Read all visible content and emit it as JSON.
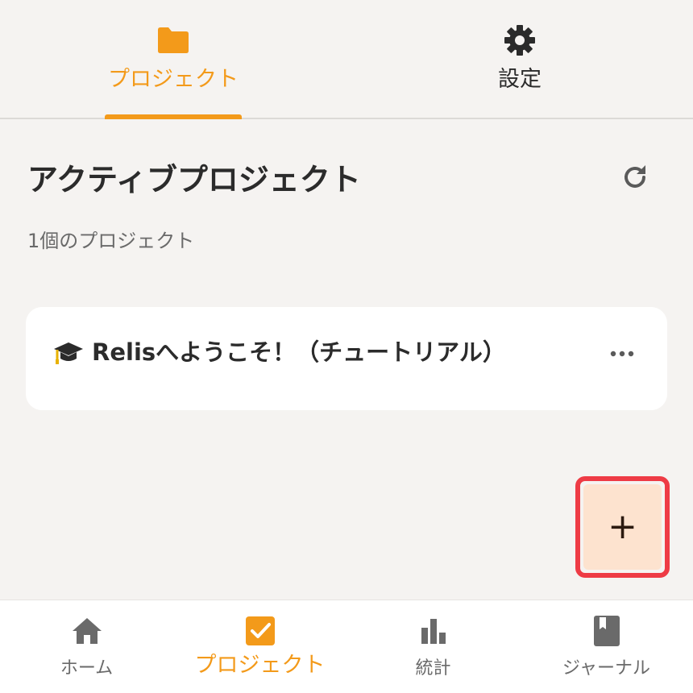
{
  "top_tabs": {
    "projects": {
      "label": "プロジェクト",
      "icon": "folder-icon"
    },
    "settings": {
      "label": "設定",
      "icon": "gear-icon"
    }
  },
  "section": {
    "title": "アクティブプロジェクト",
    "count_text": "1個のプロジェクト"
  },
  "project_card": {
    "icon": "graduation-cap-icon",
    "title": "Relisへようこそ！（チュートリアル）"
  },
  "fab": {
    "label": "+"
  },
  "bottom_nav": {
    "home": {
      "label": "ホーム",
      "icon": "home-icon"
    },
    "projects": {
      "label": "プロジェクト",
      "icon": "checkbox-icon"
    },
    "stats": {
      "label": "統計",
      "icon": "bar-chart-icon"
    },
    "journal": {
      "label": "ジャーナル",
      "icon": "book-icon"
    }
  },
  "colors": {
    "accent": "#f39a1a",
    "background": "#f5f3f1",
    "fab_background": "#fde3cf",
    "highlight": "#ee3b45"
  }
}
